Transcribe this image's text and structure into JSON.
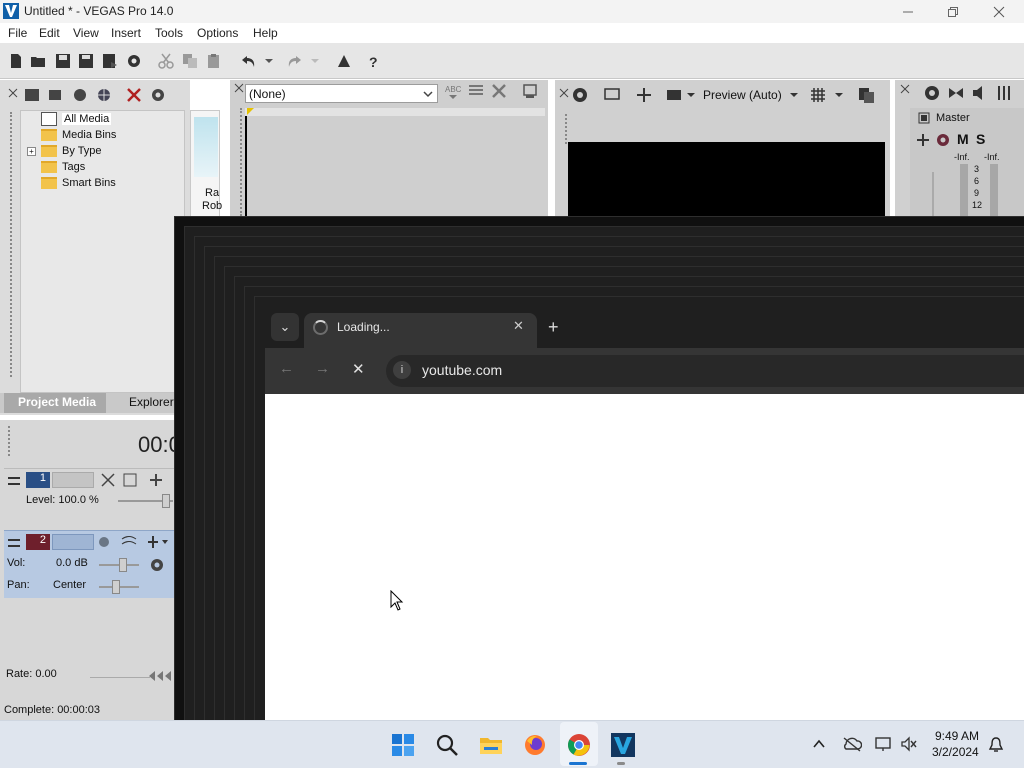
{
  "window": {
    "title": "Untitled * - VEGAS Pro 14.0",
    "controls": [
      "minimize",
      "restore",
      "close"
    ]
  },
  "menu": [
    "File",
    "Edit",
    "View",
    "Insert",
    "Tools",
    "Options",
    "Help"
  ],
  "project_media": {
    "tree": [
      "All Media",
      "Media Bins",
      "By Type",
      "Tags",
      "Smart Bins"
    ],
    "expander": "+",
    "clip_label": [
      "Ra",
      "Rob"
    ],
    "tabs": [
      "Project Media",
      "Explorer"
    ]
  },
  "trimmer": {
    "dropdown_value": "(None)"
  },
  "preview": {
    "mode": "Preview (Auto)"
  },
  "mixer": {
    "label": "Master",
    "m": "M",
    "s": "S",
    "inf_left": "-Inf.",
    "inf_right": "-Inf.",
    "scale": [
      "3",
      "6",
      "9",
      "12"
    ]
  },
  "timeline": {
    "time": "00:0",
    "track1": {
      "number": "1",
      "level_label": "Level: 100.0 %"
    },
    "track2": {
      "number": "2",
      "vol_label": "Vol:",
      "vol_value": "0.0 dB",
      "pan_label": "Pan:",
      "pan_value": "Center"
    },
    "rate": "Rate: 0.00",
    "complete": "Complete: 00:00:03"
  },
  "browser": {
    "tab_title": "Loading...",
    "tab_close": "✕",
    "new_tab": "+",
    "tab_search": "⌄",
    "url": "youtube.com",
    "info": "i",
    "back": "←",
    "forward": "→",
    "stop": "✕"
  },
  "taskbar": {
    "apps": [
      "start-icon",
      "search-icon",
      "file-explorer-icon",
      "firefox-icon",
      "chrome-icon",
      "vegas-icon"
    ],
    "time": "9:49 AM",
    "date": "3/2/2024"
  },
  "colors": {
    "vegas_bg": "#dcdcdc",
    "chrome_dark": "#1f1f1f",
    "chrome_toolbar": "#353535",
    "taskbar": "#dfe5ee",
    "track2_bg": "#b7c9e2"
  }
}
